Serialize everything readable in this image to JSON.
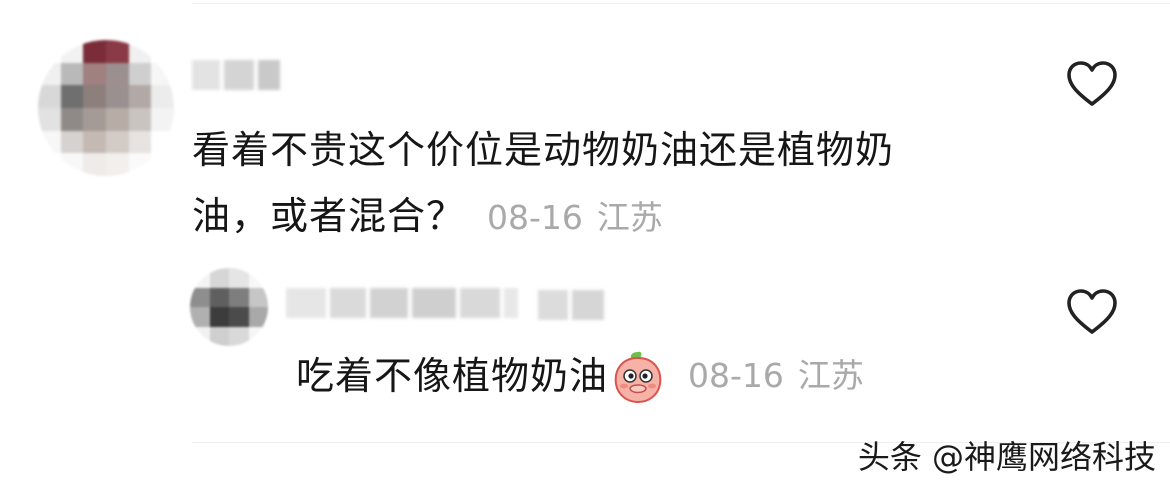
{
  "comments": [
    {
      "text_line1": "看着不贵这个价位是动物奶油还是植物奶",
      "text_line2": "油，或者混合？",
      "date": "08-16",
      "location": "江苏"
    }
  ],
  "reply": {
    "text": "吃着不像植物奶油",
    "date": "08-16",
    "location": "江苏",
    "emoji_icon": "peach-cover-mouth-emoji"
  },
  "watermark": "头条 @神鹰网络科技",
  "icons": {
    "like": "heart-outline-icon"
  },
  "colors": {
    "text": "#161616",
    "meta": "#a9a9a9",
    "divider": "#efefef"
  }
}
